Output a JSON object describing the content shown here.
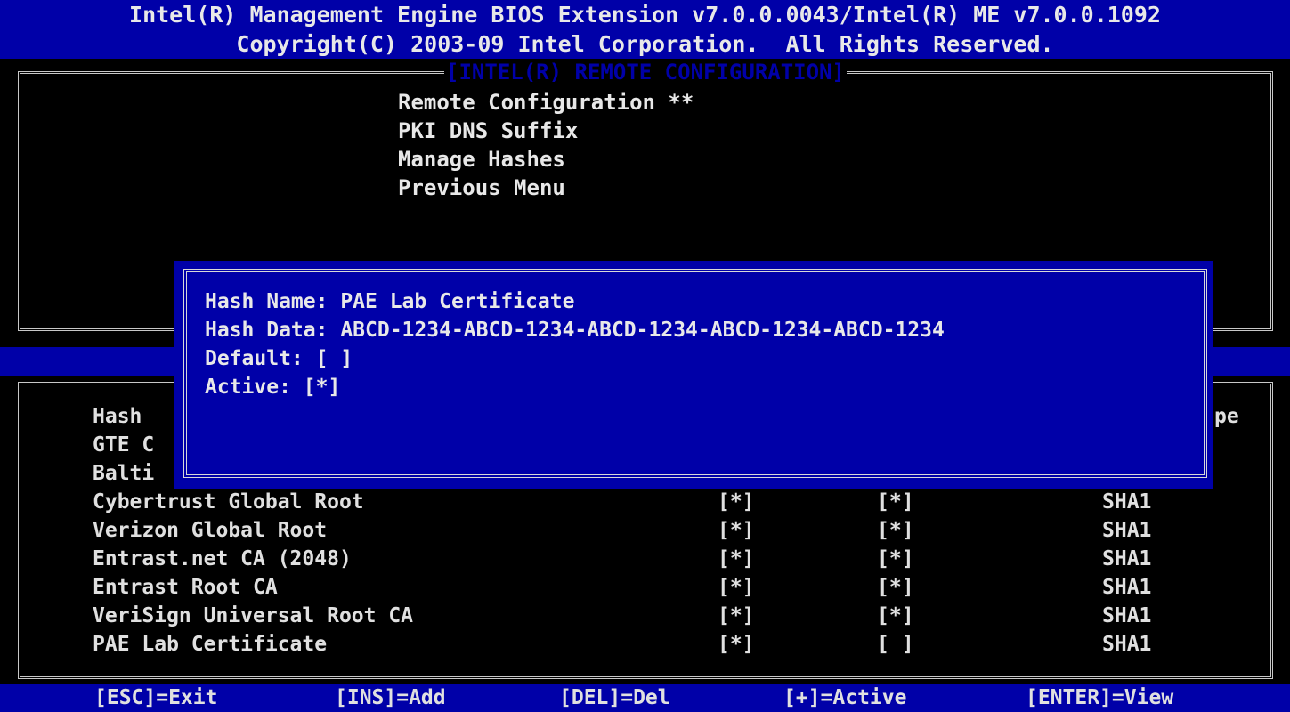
{
  "header": {
    "line1": "Intel(R) Management Engine BIOS Extension v7.0.0.0043/Intel(R) ME v7.0.0.1092",
    "line2": "Copyright(C) 2003-09 Intel Corporation.  All Rights Reserved."
  },
  "menu": {
    "title": "[INTEL(R) REMOTE CONFIGURATION]",
    "items": [
      "Remote Configuration **",
      "PKI DNS Suffix",
      "Manage Hashes",
      "Previous Menu"
    ]
  },
  "table": {
    "partial_header_left": "Hash",
    "partial_header_right": "pe",
    "partial_rows": [
      "GTE C",
      "Balti"
    ],
    "rows": [
      {
        "name": "Cybertrust Global Root",
        "default": "[*]",
        "active": "[*]",
        "type": "SHA1"
      },
      {
        "name": "Verizon Global Root",
        "default": "[*]",
        "active": "[*]",
        "type": "SHA1"
      },
      {
        "name": "Entrast.net CA (2048)",
        "default": "[*]",
        "active": "[*]",
        "type": "SHA1"
      },
      {
        "name": "Entrast Root CA",
        "default": "[*]",
        "active": "[*]",
        "type": "SHA1"
      },
      {
        "name": "VeriSign Universal Root CA",
        "default": "[*]",
        "active": "[*]",
        "type": "SHA1"
      },
      {
        "name": "PAE Lab Certificate",
        "default": "[*]",
        "active": "[ ]",
        "type": "SHA1"
      }
    ]
  },
  "dialog": {
    "hash_name": "Hash Name: PAE Lab Certificate",
    "hash_data": "Hash Data: ABCD-1234-ABCD-1234-ABCD-1234-ABCD-1234-ABCD-1234",
    "default": "Default: [ ]",
    "active": "Active: [*]"
  },
  "footer": {
    "esc": "[ESC]=Exit",
    "ins": "[INS]=Add",
    "del": "[DEL]=Del",
    "plus": "[+]=Active",
    "enter": "[ENTER]=View"
  }
}
